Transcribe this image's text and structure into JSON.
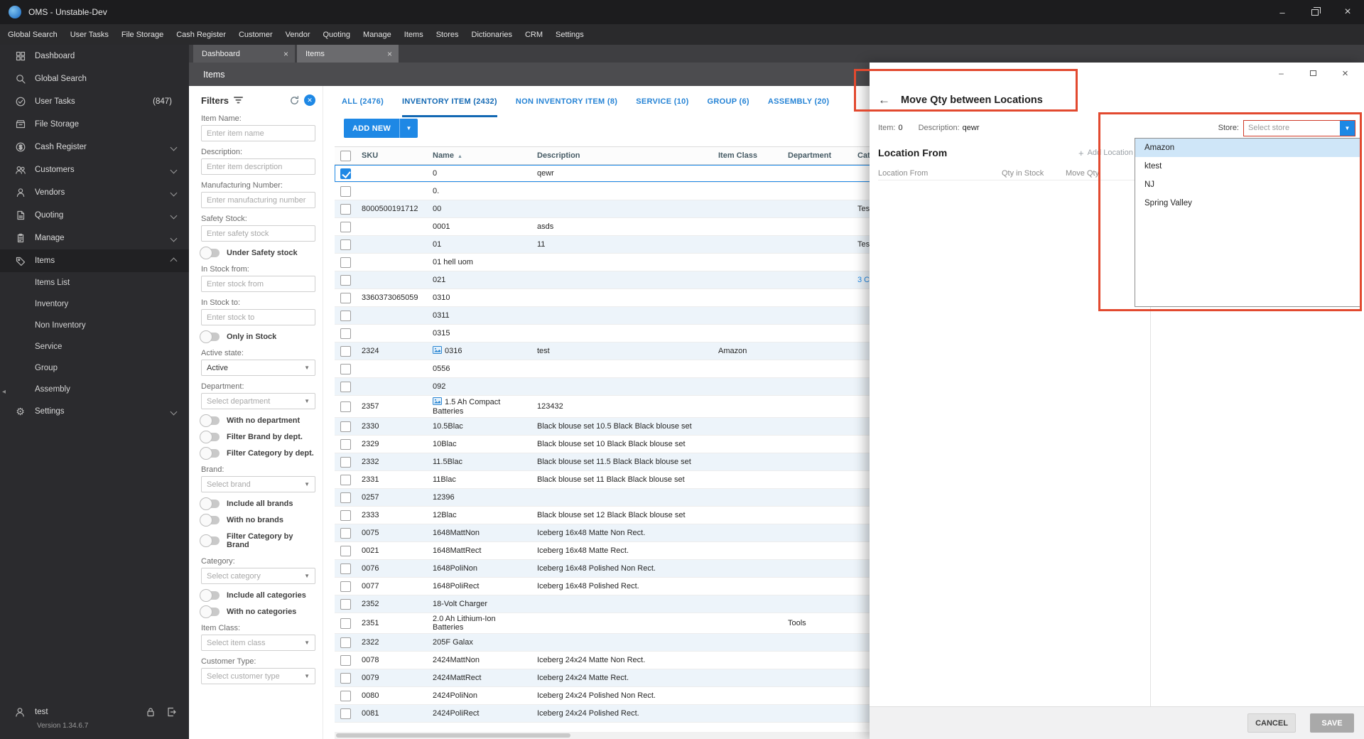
{
  "titlebar": {
    "app_title": "OMS - Unstable-Dev"
  },
  "menubar": {
    "items": [
      "Global Search",
      "User Tasks",
      "File Storage",
      "Cash Register",
      "Customer",
      "Vendor",
      "Quoting",
      "Manage",
      "Items",
      "Stores",
      "Dictionaries",
      "CRM",
      "Settings"
    ]
  },
  "sidebar": {
    "items": [
      {
        "label": "Dashboard"
      },
      {
        "label": "Global Search"
      },
      {
        "label": "User Tasks",
        "badge": "(847)"
      },
      {
        "label": "File Storage"
      },
      {
        "label": "Cash Register"
      },
      {
        "label": "Customers"
      },
      {
        "label": "Vendors"
      },
      {
        "label": "Quoting"
      },
      {
        "label": "Manage"
      },
      {
        "label": "Items"
      }
    ],
    "sub_items": [
      "Items List",
      "Inventory",
      "Non Inventory",
      "Service",
      "Group",
      "Assembly"
    ],
    "settings_label": "Settings",
    "user": "test",
    "version": "Version 1.34.6.7"
  },
  "doc_tabs": [
    {
      "label": "Dashboard"
    },
    {
      "label": "Items"
    }
  ],
  "page": {
    "title": "Items"
  },
  "filters": {
    "title": "Filters",
    "item_name": {
      "label": "Item Name:",
      "placeholder": "Enter item name"
    },
    "description": {
      "label": "Description:",
      "placeholder": "Enter item description"
    },
    "mfg": {
      "label": "Manufacturing Number:",
      "placeholder": "Enter manufacturing number"
    },
    "safety": {
      "label": "Safety Stock:",
      "placeholder": "Enter safety stock"
    },
    "under_safety_toggle": "Under Safety stock",
    "stock_from": {
      "label": "In Stock from:",
      "placeholder": "Enter stock from"
    },
    "stock_to": {
      "label": "In Stock to:",
      "placeholder": "Enter stock to"
    },
    "only_in_stock_toggle": "Only in Stock",
    "active_state": {
      "label": "Active state:",
      "value": "Active"
    },
    "department": {
      "label": "Department:",
      "placeholder": "Select department"
    },
    "no_department_toggle": "With no department",
    "brand_by_dept_toggle": "Filter Brand by dept.",
    "category_by_dept_toggle": "Filter Category by dept.",
    "brand": {
      "label": "Brand:",
      "placeholder": "Select brand"
    },
    "all_brands_toggle": "Include all brands",
    "no_brands_toggle": "With no brands",
    "category_by_brand_toggle": "Filter Category by Brand",
    "category": {
      "label": "Category:",
      "placeholder": "Select category"
    },
    "all_categories_toggle": "Include all categories",
    "no_categories_toggle": "With no categories",
    "item_class": {
      "label": "Item Class:",
      "placeholder": "Select item class"
    },
    "customer_type": {
      "label": "Customer Type:",
      "placeholder": "Select customer type"
    }
  },
  "main": {
    "type_tabs": [
      {
        "label": "ALL (2476)"
      },
      {
        "label": "INVENTORY ITEM (2432)",
        "active": true
      },
      {
        "label": "NON INVENTORY ITEM (8)"
      },
      {
        "label": "SERVICE (10)"
      },
      {
        "label": "GROUP (6)"
      },
      {
        "label": "ASSEMBLY (20)"
      }
    ],
    "add_new_label": "ADD NEW",
    "table": {
      "headers": {
        "sku": "SKU",
        "name": "Name",
        "description": "Description",
        "item_class": "Item Class",
        "department": "Department",
        "category": "Cat"
      },
      "rows": [
        {
          "name": "0",
          "desc": "qewr",
          "checked": true,
          "selected": true
        },
        {
          "name": "0."
        },
        {
          "sku": "8000500191712",
          "name": "00",
          "cat": "Tes"
        },
        {
          "name": "0001",
          "desc": "asds"
        },
        {
          "name": "01",
          "desc": "11",
          "cat": "Tes"
        },
        {
          "name": "01 hell uom"
        },
        {
          "name": "021",
          "cat": "3 C",
          "cat_link": true
        },
        {
          "sku": "3360373065059",
          "name": "0310"
        },
        {
          "name": "0311"
        },
        {
          "name": "0315"
        },
        {
          "sku": "2324",
          "name": "0316",
          "desc": "test",
          "cls": "Amazon",
          "img": true
        },
        {
          "name": "0556"
        },
        {
          "name": "092"
        },
        {
          "sku": "2357",
          "name": "1.5 Ah Compact Batteries",
          "desc": "123432",
          "img": true
        },
        {
          "sku": "2330",
          "name": "10.5Blac",
          "desc": "Black blouse set 10.5 Black Black blouse set"
        },
        {
          "sku": "2329",
          "name": "10Blac",
          "desc": "Black blouse set 10 Black Black blouse set"
        },
        {
          "sku": "2332",
          "name": "11.5Blac",
          "desc": "Black blouse set 11.5 Black Black blouse set"
        },
        {
          "sku": "2331",
          "name": "11Blac",
          "desc": "Black blouse set 11 Black Black blouse set"
        },
        {
          "sku": "0257",
          "name": "12396"
        },
        {
          "sku": "2333",
          "name": "12Blac",
          "desc": "Black blouse set 12 Black Black blouse set"
        },
        {
          "sku": "0075",
          "name": "1648MattNon",
          "desc": "Iceberg 16x48 Matte Non Rect."
        },
        {
          "sku": "0021",
          "name": "1648MattRect",
          "desc": "Iceberg 16x48 Matte Rect."
        },
        {
          "sku": "0076",
          "name": "1648PoliNon",
          "desc": "Iceberg 16x48 Polished Non Rect."
        },
        {
          "sku": "0077",
          "name": "1648PoliRect",
          "desc": "Iceberg 16x48 Polished Rect."
        },
        {
          "sku": "2352",
          "name": "18-Volt Charger"
        },
        {
          "sku": "2351",
          "name": "2.0 Ah Lithium-Ion Batteries",
          "dept": "Tools"
        },
        {
          "sku": "2322",
          "name": "205F Galax"
        },
        {
          "sku": "0078",
          "name": "2424MattNon",
          "desc": "Iceberg 24x24 Matte Non Rect."
        },
        {
          "sku": "0079",
          "name": "2424MattRect",
          "desc": "Iceberg 24x24 Matte Rect."
        },
        {
          "sku": "0080",
          "name": "2424PoliNon",
          "desc": "Iceberg 24x24 Polished Non Rect."
        },
        {
          "sku": "0081",
          "name": "2424PoliRect",
          "desc": "Iceberg 24x24 Polished Rect."
        }
      ]
    }
  },
  "modal": {
    "title": "Move Qty between Locations",
    "item_label": "Item:",
    "item_value": "0",
    "description_label": "Description:",
    "description_value": "qewr",
    "store_label": "Store:",
    "store_placeholder": "Select store",
    "store_options": [
      {
        "label": "Amazon",
        "highlighted": true
      },
      {
        "label": "ktest"
      },
      {
        "label": "NJ"
      },
      {
        "label": "Spring Valley"
      }
    ],
    "section_title": "Location From",
    "add_location_label": "Add Location",
    "columns": {
      "location_from": "Location From",
      "qty_in_stock": "Qty in Stock",
      "move_qty": "Move Qty"
    },
    "cancel_label": "CANCEL",
    "save_label": "SAVE"
  },
  "colors": {
    "accent": "#1e88e5",
    "annotation_red": "#e2492f",
    "selected_option_bg": "#cfe6f8"
  }
}
